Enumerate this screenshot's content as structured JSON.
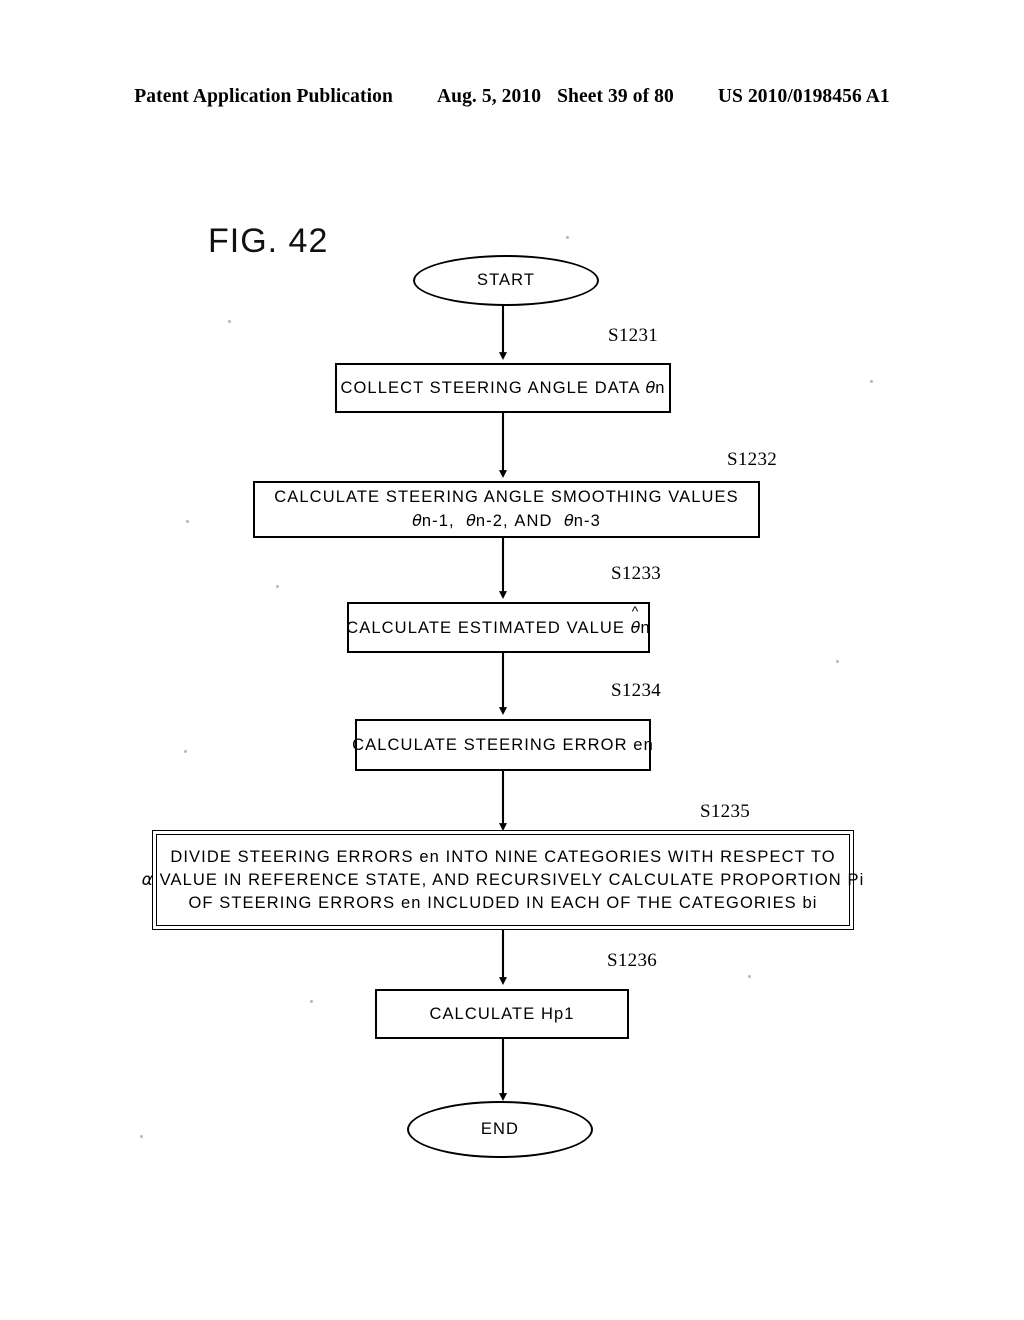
{
  "header": {
    "publication": "Patent Application Publication",
    "date": "Aug. 5, 2010",
    "sheet": "Sheet 39 of 80",
    "patent_number": "US 2010/0198456 A1"
  },
  "figure": {
    "title": "FIG. 42"
  },
  "flowchart": {
    "start_label": "START",
    "end_label": "END",
    "nodes": [
      {
        "id": "s1231",
        "step": "S1231",
        "text_plain": "COLLECT STEERING ANGLE DATA θn",
        "line1_pre": "COLLECT STEERING ANGLE DATA ",
        "line1_theta": "θ",
        "line1_post": "n"
      },
      {
        "id": "s1232",
        "step": "S1232",
        "text_plain": "CALCULATE STEERING ANGLE SMOOTHING VALUES θn-1, θn-2, AND θn-3",
        "line1": "CALCULATE STEERING ANGLE SMOOTHING VALUES",
        "line2_a": "n-1,",
        "line2_b": "n-2,",
        "line2_and": "AND",
        "line2_c": "n-3"
      },
      {
        "id": "s1233",
        "step": "S1233",
        "text_plain": "CALCULATE ESTIMATED VALUE θ̂n",
        "line1_pre": "CALCULATE ESTIMATED VALUE ",
        "hat": "^",
        "line1_post": "n"
      },
      {
        "id": "s1234",
        "step": "S1234",
        "text_plain": "CALCULATE STEERING ERROR en",
        "line1": "CALCULATE STEERING ERROR en"
      },
      {
        "id": "s1235",
        "step": "S1235",
        "text_plain": "DIVIDE STEERING ERRORS en INTO NINE CATEGORIES WITH RESPECT TO α VALUE IN REFERENCE STATE, AND RECURSIVELY CALCULATE PROPORTION Pi OF STEERING ERRORS en INCLUDED IN EACH OF THE CATEGORIES bi",
        "line1": "DIVIDE STEERING ERRORS en INTO NINE CATEGORIES WITH RESPECT TO",
        "line2_alpha": "α",
        "line2": "VALUE IN REFERENCE STATE, AND RECURSIVELY CALCULATE PROPORTION Pi",
        "line3": "OF STEERING ERRORS en INCLUDED IN EACH OF THE CATEGORIES bi"
      },
      {
        "id": "s1236",
        "step": "S1236",
        "text_plain": "CALCULATE Hp1",
        "line1": "CALCULATE Hp1"
      }
    ]
  },
  "style": {
    "ink": "#000000",
    "paper": "#ffffff"
  }
}
